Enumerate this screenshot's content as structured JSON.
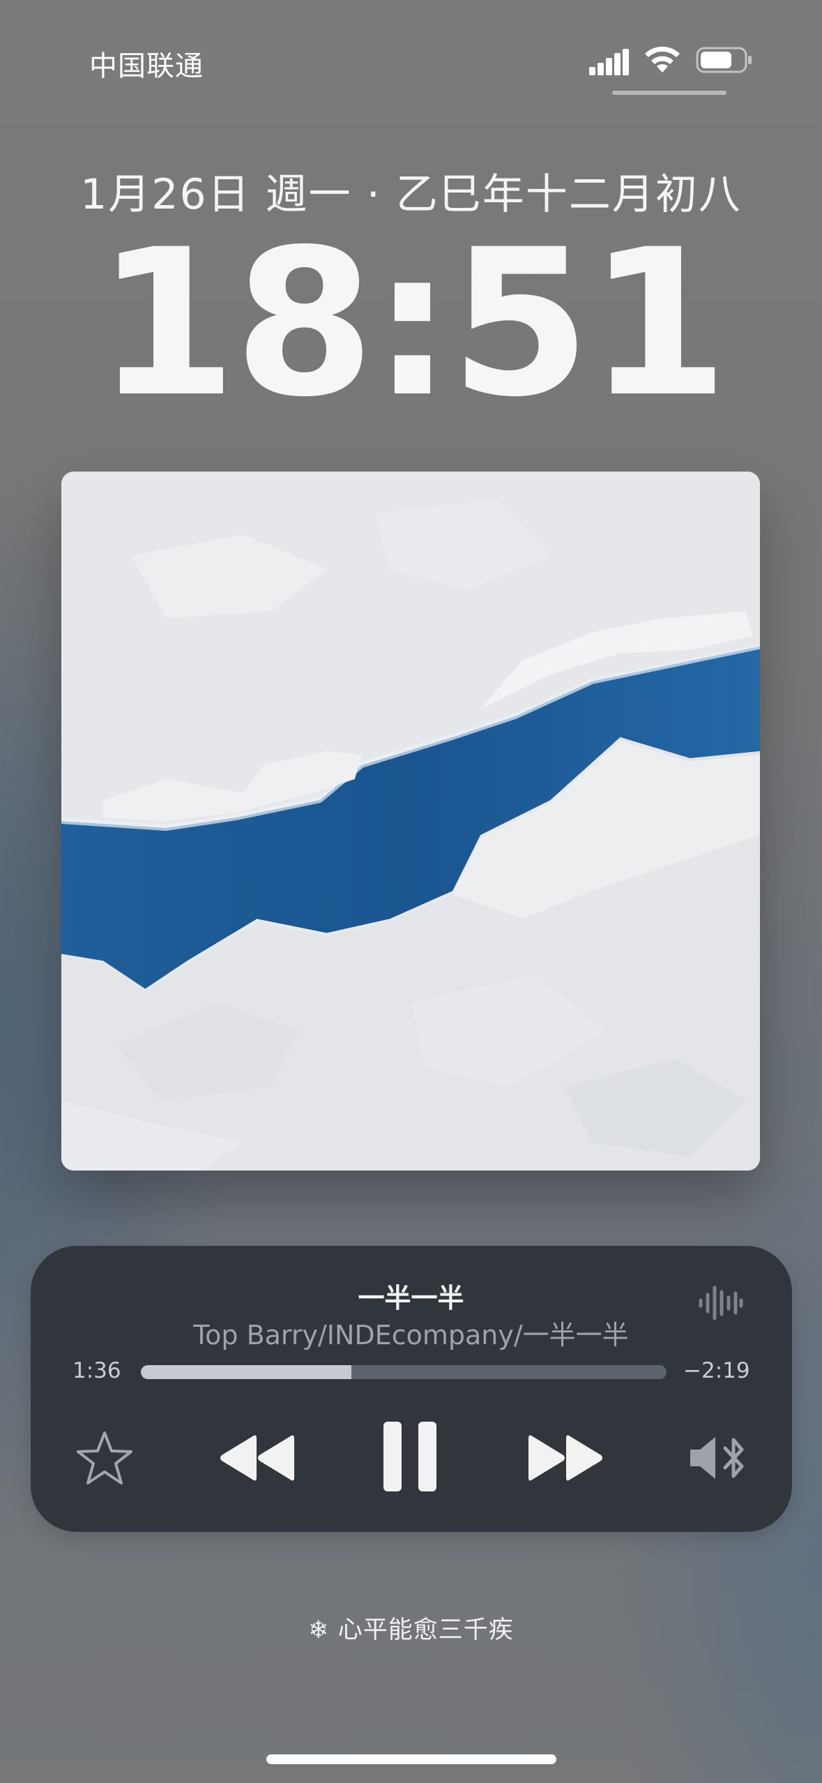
{
  "status_bar": {
    "carrier": "中国联通",
    "icons": [
      "cellular-signal-icon",
      "wifi-icon",
      "battery-icon"
    ]
  },
  "lock_screen": {
    "date": "1月26日 週一 · 乙巳年十二月初八",
    "time": "18:51"
  },
  "now_playing": {
    "artwork": "album-artwork-ice-river",
    "title": "一半一半",
    "artist_line": "Top Barry/INDEcompany/一半一半",
    "elapsed": "1:36",
    "remaining": "−2:19",
    "progress_fraction": 0.4,
    "controls": [
      "star-icon",
      "rewind-icon",
      "pause-icon",
      "fast-forward-icon",
      "speaker-bluetooth-icon"
    ],
    "waveform_icon": "waveform-icon"
  },
  "footer": {
    "text": "❄ 心平能愈三千疾"
  },
  "colors": {
    "player_background": "#31363d",
    "progress_fill": "#c7cad0",
    "progress_track": "#5d636b",
    "water": "#1f5f9a"
  }
}
